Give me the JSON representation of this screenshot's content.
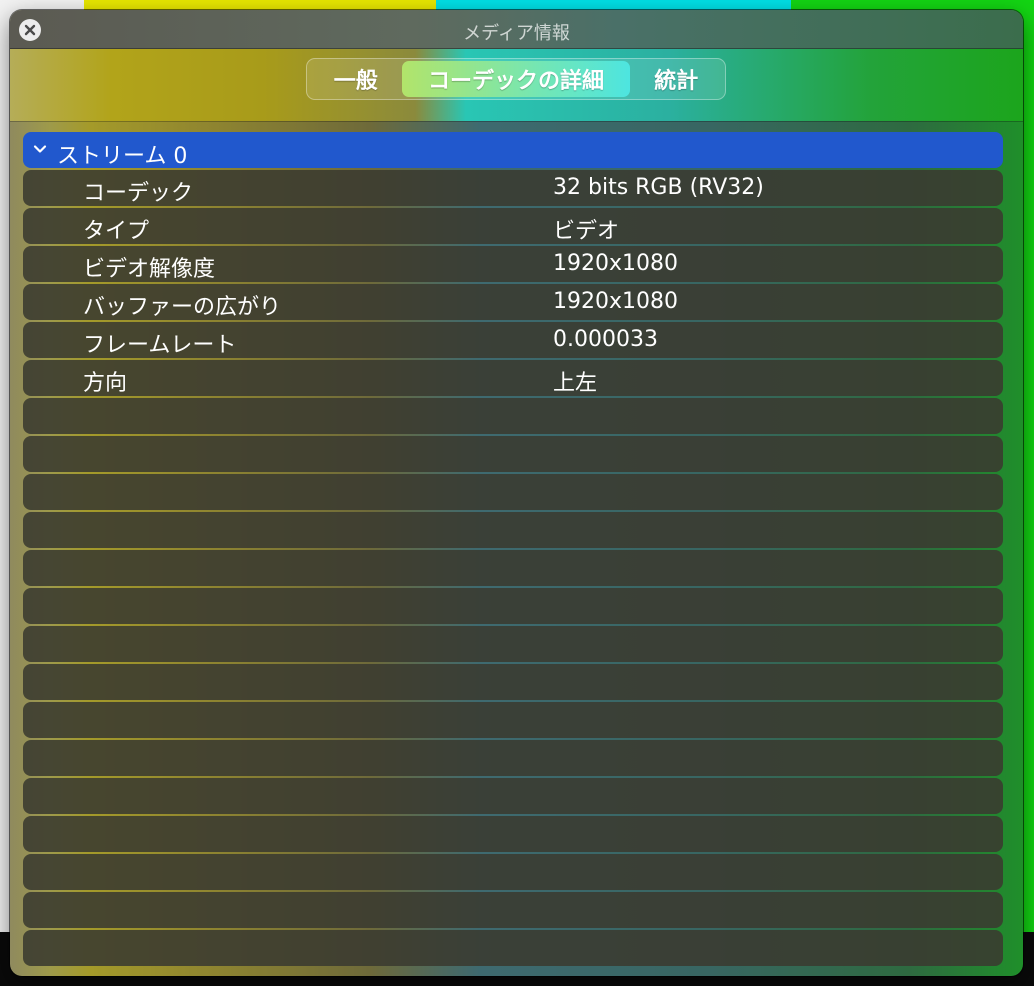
{
  "window": {
    "title": "メディア情報"
  },
  "tabs": [
    {
      "label": "一般",
      "selected": false
    },
    {
      "label": "コーデックの詳細",
      "selected": true
    },
    {
      "label": "統計",
      "selected": false
    }
  ],
  "stream": {
    "title": "ストリーム 0",
    "expanded": true,
    "properties": [
      {
        "name": "コーデック",
        "value": "32 bits RGB (RV32)"
      },
      {
        "name": "タイプ",
        "value": "ビデオ"
      },
      {
        "name": "ビデオ解像度",
        "value": "1920x1080"
      },
      {
        "name": "バッファーの広がり",
        "value": "1920x1080"
      },
      {
        "name": "フレームレート",
        "value": "0.000033"
      },
      {
        "name": "方向",
        "value": "上左"
      }
    ]
  },
  "colors": {
    "selection": "#2158cd",
    "row": "#3a3a30"
  }
}
